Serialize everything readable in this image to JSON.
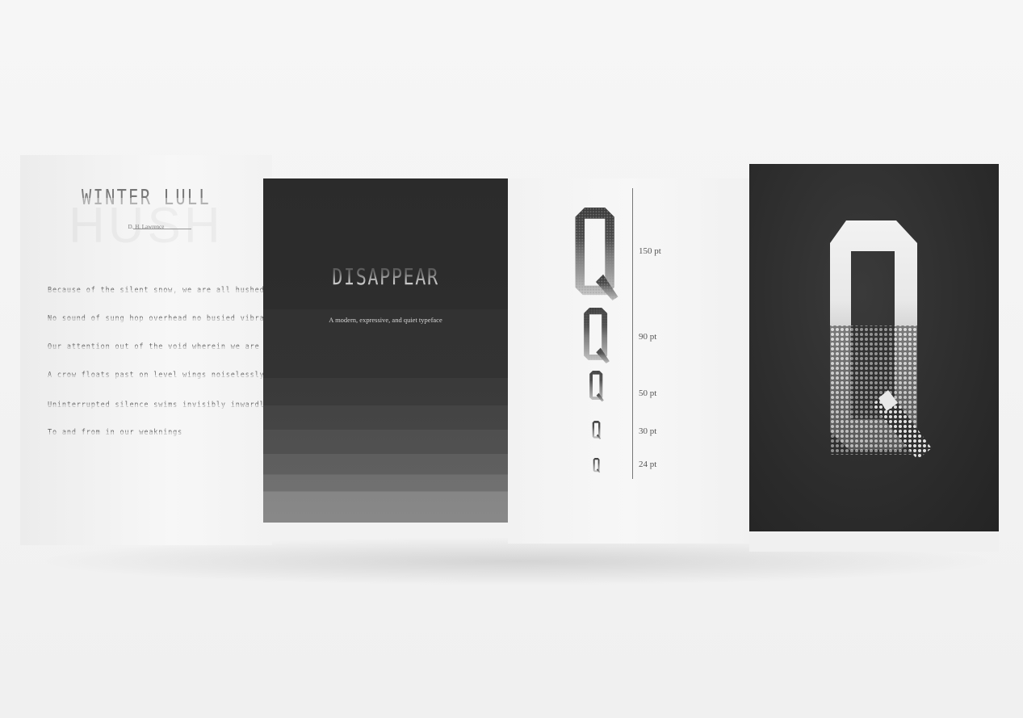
{
  "poem": {
    "title": "WINTER LULL",
    "author": "D. H. Lawrence",
    "lines": [
      "Because of the silent snow, we are all hushed into one",
      "No sound of sung hop overhead no busied vibration to draw",
      "Our attention out of the void wherein we are crushed",
      "A crow floats past on level wings noiselessly",
      "Uninterrupted silence swims invisibly inwardly",
      "To and from in our weaknings"
    ]
  },
  "cover": {
    "title": "DISAPPEAR",
    "subtitle": "A modern, expressive, and quiet typeface"
  },
  "specimen": {
    "glyph": "Q",
    "sizes": [
      {
        "label": "150 pt",
        "pt": 150
      },
      {
        "label": "90 pt",
        "pt": 90
      },
      {
        "label": "50 pt",
        "pt": 50
      },
      {
        "label": "30 pt",
        "pt": 30
      },
      {
        "label": "24 pt",
        "pt": 24
      }
    ]
  },
  "colors": {
    "paper": "#f4f4f4",
    "dark_panel": "#2b2b2b",
    "ink": "#555555"
  }
}
